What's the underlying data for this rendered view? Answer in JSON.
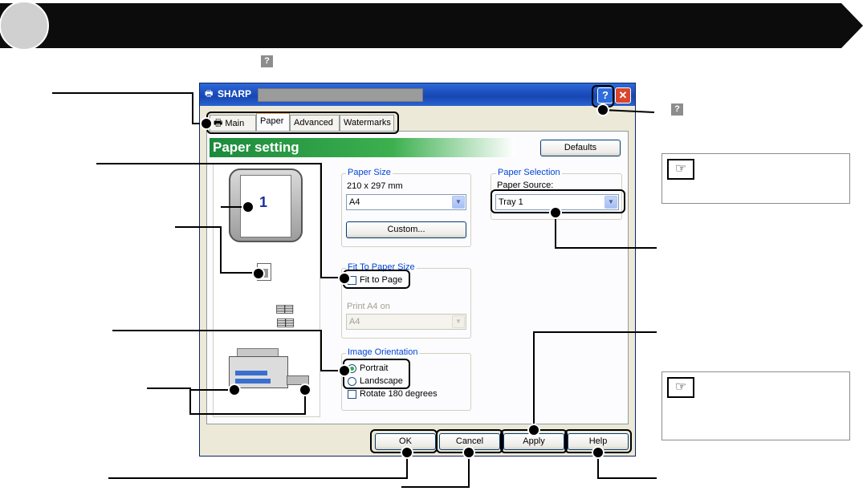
{
  "header": {
    "band_color": "#0c0c0c",
    "circle_color": "#d0d0d0"
  },
  "top_note": {
    "icon": "help-icon"
  },
  "dialog": {
    "title": "SHARP",
    "help_button": "?",
    "close_button": "✕",
    "tabs": [
      {
        "label": "Main",
        "active": false,
        "icon": "printer-icon"
      },
      {
        "label": "Paper",
        "active": true
      },
      {
        "label": "Advanced",
        "active": false
      },
      {
        "label": "Watermarks",
        "active": false
      }
    ],
    "banner_title": "Paper setting",
    "defaults_button": "Defaults",
    "preview": {
      "page_number": "1"
    },
    "paper_size": {
      "group_title": "Paper Size",
      "dimensions": "210 x 297 mm",
      "selected": "A4",
      "custom_button": "Custom..."
    },
    "fit_to_paper": {
      "group_title": "Fit To Paper Size",
      "checkbox_label": "Fit to Page",
      "checked": false,
      "print_on_label": "Print A4 on",
      "print_on_value": "A4"
    },
    "orientation": {
      "group_title": "Image Orientation",
      "portrait": "Portrait",
      "landscape": "Landscape",
      "selected": "Portrait",
      "rotate_label": "Rotate 180 degrees",
      "rotate_checked": false
    },
    "paper_selection": {
      "group_title": "Paper Selection",
      "source_label": "Paper Source:",
      "source_value": "Tray 1"
    },
    "buttons": {
      "ok": "OK",
      "cancel": "Cancel",
      "apply": "Apply",
      "help": "Help"
    }
  },
  "right_note": {
    "icon": "help-icon"
  },
  "reference_boxes": [
    {
      "icon": "pointing-hand-icon"
    },
    {
      "icon": "pointing-hand-icon"
    }
  ]
}
